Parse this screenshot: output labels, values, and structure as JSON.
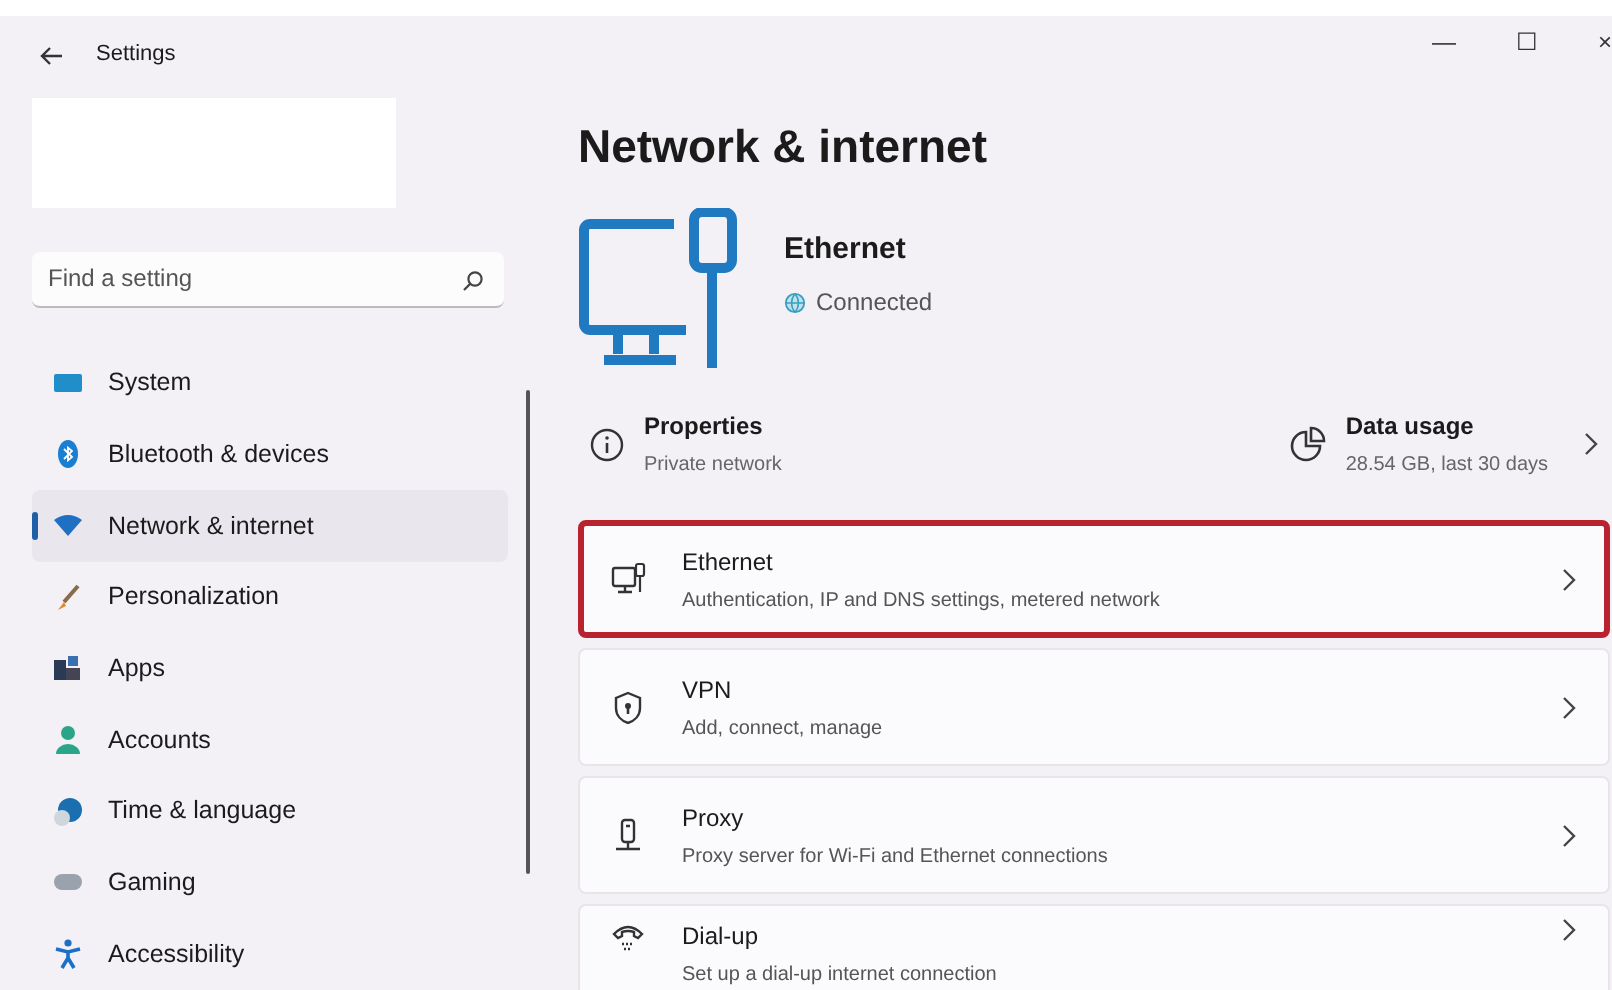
{
  "window": {
    "title": "Settings",
    "controls": [
      "—",
      "☐",
      "×"
    ]
  },
  "search": {
    "placeholder": "Find a setting"
  },
  "sidebar": {
    "items": [
      {
        "label": "System",
        "selected": false
      },
      {
        "label": "Bluetooth & devices",
        "selected": false
      },
      {
        "label": "Network & internet",
        "selected": true
      },
      {
        "label": "Personalization",
        "selected": false
      },
      {
        "label": "Apps",
        "selected": false
      },
      {
        "label": "Accounts",
        "selected": false
      },
      {
        "label": "Time & language",
        "selected": false
      },
      {
        "label": "Gaming",
        "selected": false
      },
      {
        "label": "Accessibility",
        "selected": false
      }
    ]
  },
  "page": {
    "title": "Network & internet",
    "connection": {
      "name": "Ethernet",
      "status": "Connected"
    },
    "properties": {
      "title": "Properties",
      "subtitle": "Private network"
    },
    "data_usage": {
      "title": "Data usage",
      "subtitle": "28.54 GB, last 30 days"
    },
    "cards": [
      {
        "title": "Ethernet",
        "subtitle": "Authentication, IP and DNS settings, metered network",
        "highlighted": true
      },
      {
        "title": "VPN",
        "subtitle": "Add, connect, manage",
        "highlighted": false
      },
      {
        "title": "Proxy",
        "subtitle": "Proxy server for Wi-Fi and Ethernet connections",
        "highlighted": false
      },
      {
        "title": "Dial-up",
        "subtitle": "Set up a dial-up internet connection",
        "highlighted": false
      }
    ]
  }
}
